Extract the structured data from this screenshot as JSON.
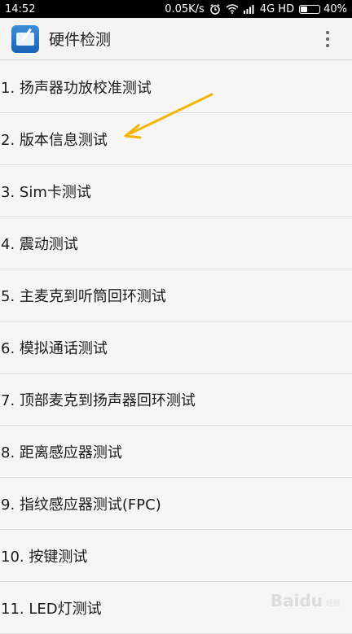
{
  "status_bar": {
    "time": "14:52",
    "speed": "0.05K/s",
    "network": "4G HD",
    "battery": "40%",
    "battery_level": 0.4,
    "icons": [
      "alarm-icon",
      "wifi-icon",
      "signal-icon",
      "battery-icon"
    ]
  },
  "action_bar": {
    "title": "硬件检测",
    "app_icon": "hardware-test-app-icon",
    "menu_icon": "overflow-menu-icon"
  },
  "items": [
    {
      "label": "1. 扬声器功放校准测试"
    },
    {
      "label": "2. 版本信息测试"
    },
    {
      "label": "3. Sim卡测试"
    },
    {
      "label": "4. 震动测试"
    },
    {
      "label": "5. 主麦克到听筒回环测试"
    },
    {
      "label": "6. 模拟通话测试"
    },
    {
      "label": "7. 顶部麦克到扬声器回环测试"
    },
    {
      "label": "8. 距离感应器测试"
    },
    {
      "label": "9. 指纹感应器测试(FPC)"
    },
    {
      "label": "10. 按键测试"
    },
    {
      "label": "11. LED灯测试"
    }
  ],
  "annotation": {
    "color": "#f5b400"
  },
  "watermark": {
    "logo": "Baidu",
    "sub": "经验"
  },
  "colors": {
    "status_bar_bg": "#000000",
    "action_bar_bg": "#f4f4f4",
    "list_bg": "#f6f6f6",
    "divider": "#dedede"
  }
}
